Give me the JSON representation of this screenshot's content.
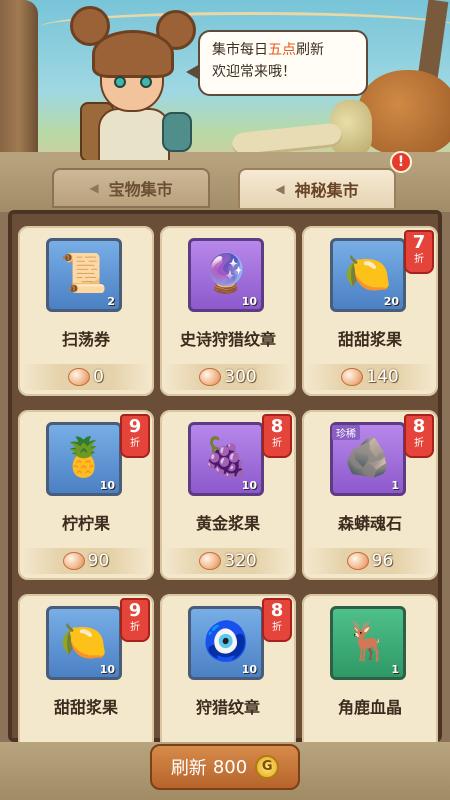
{
  "header": {
    "bubble_line1_a": "集市每日",
    "bubble_line1_highlight": "五点",
    "bubble_line1_b": "刷新",
    "bubble_line2": "欢迎常来哦！"
  },
  "tabs": [
    {
      "label": "宝物集市",
      "active": false
    },
    {
      "label": "神秘集市",
      "active": true
    }
  ],
  "alert_badge": "!",
  "items": [
    {
      "name": "扫荡券",
      "qty": "2",
      "price": "0",
      "discount": null,
      "discount_unit": null,
      "rare": null,
      "icon": "scroll-map-icon",
      "glyph": "📜",
      "frame": "blue"
    },
    {
      "name": "史诗狩猎纹章",
      "qty": "10",
      "price": "300",
      "discount": null,
      "discount_unit": null,
      "rare": null,
      "icon": "epic-hunt-emblem-icon",
      "glyph": "🔮",
      "frame": "purple"
    },
    {
      "name": "甜甜浆果",
      "qty": "20",
      "price": "140",
      "discount": "7",
      "discount_unit": "折",
      "rare": null,
      "icon": "sweet-berry-icon",
      "glyph": "🍋",
      "frame": "blue"
    },
    {
      "name": "柠柠果",
      "qty": "10",
      "price": "90",
      "discount": "9",
      "discount_unit": "折",
      "rare": null,
      "icon": "lemon-fruit-icon",
      "glyph": "🍍",
      "frame": "blue"
    },
    {
      "name": "黄金浆果",
      "qty": "10",
      "price": "320",
      "discount": "8",
      "discount_unit": "折",
      "rare": null,
      "icon": "golden-berry-icon",
      "glyph": "🍇",
      "frame": "purple"
    },
    {
      "name": "森蟒魂石",
      "qty": "1",
      "price": "96",
      "discount": "8",
      "discount_unit": "折",
      "rare": "珍稀",
      "icon": "serpent-soul-stone-icon",
      "glyph": "🪨",
      "frame": "purple"
    },
    {
      "name": "甜甜浆果",
      "qty": "10",
      "price": "",
      "discount": "9",
      "discount_unit": "折",
      "rare": null,
      "icon": "sweet-berry-icon",
      "glyph": "🍋",
      "frame": "blue"
    },
    {
      "name": "狩猎纹章",
      "qty": "10",
      "price": "",
      "discount": "8",
      "discount_unit": "折",
      "rare": null,
      "icon": "hunt-emblem-icon",
      "glyph": "🧿",
      "frame": "blue"
    },
    {
      "name": "角鹿血晶",
      "qty": "1",
      "price": "",
      "discount": null,
      "discount_unit": null,
      "rare": null,
      "icon": "antler-deer-crystal-icon",
      "glyph": "🦌",
      "frame": "green"
    }
  ],
  "refresh": {
    "label": "刷新",
    "cost": "800",
    "coin_symbol": "G"
  }
}
